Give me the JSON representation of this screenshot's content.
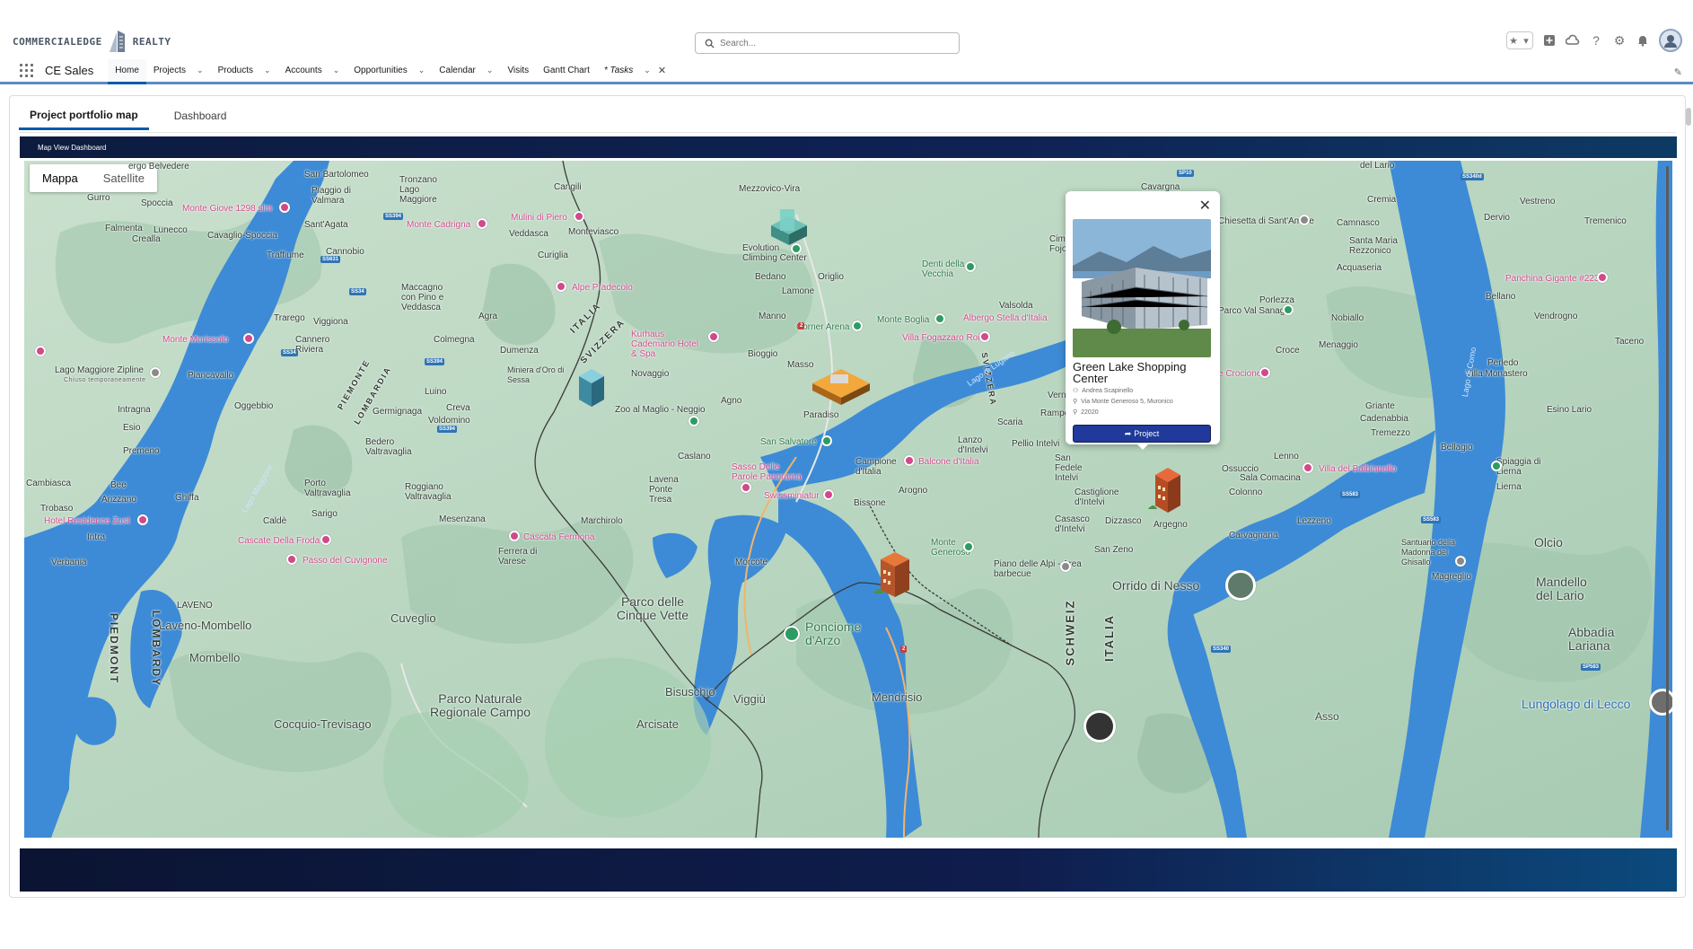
{
  "brand": {
    "name_left": "COMMERCIALEDGE",
    "name_right": "REALTY"
  },
  "search": {
    "placeholder": "Search..."
  },
  "utility_icons": [
    "favorites-star-icon",
    "add-icon",
    "cloud-icon",
    "help-icon",
    "setup-gear-icon",
    "notification-bell-icon",
    "user-avatar-icon"
  ],
  "nav": {
    "app_name": "CE Sales",
    "items": [
      {
        "label": "Home",
        "dropdown": false,
        "active": true
      },
      {
        "label": "Projects",
        "dropdown": true
      },
      {
        "label": "Products",
        "dropdown": true
      },
      {
        "label": "Accounts",
        "dropdown": true
      },
      {
        "label": "Opportunities",
        "dropdown": true
      },
      {
        "label": "Calendar",
        "dropdown": true
      },
      {
        "label": "Visits",
        "dropdown": false
      },
      {
        "label": "Gantt Chart",
        "dropdown": false
      },
      {
        "label": "* Tasks",
        "dropdown": true,
        "closable": true
      }
    ]
  },
  "page_tabs": [
    {
      "label": "Project portfolio map",
      "active": true
    },
    {
      "label": "Dashboard",
      "active": false
    }
  ],
  "map_banner": {
    "title": "Map View Dashboard"
  },
  "map": {
    "type_toggle": {
      "map": "Mappa",
      "satellite": "Satellite",
      "selected": "Mappa"
    },
    "labels": {
      "san_bartolomeo": "San Bartolomeo",
      "tronzano": "Tronzano Lago Maggiore",
      "cannobio": "Cannobio",
      "gurro": "Gurro",
      "spoccia": "Spoccia",
      "piaggio": "Piaggio di Valmara",
      "falmenta": "Falmenta",
      "crealla": "Crealla",
      "lunecco": "Lunecco",
      "cavaglio": "Cavaglio-Spoccia",
      "santagata": "Sant'Agata",
      "traffiume": "Traffiume",
      "cannero": "Cannero Riviera",
      "maccagno": "Maccagno con Pino e Veddasca",
      "trarego": "Trarego",
      "viggiona": "Viggiona",
      "agra": "Agra",
      "colmegna": "Colmegna",
      "dumenza": "Dumenza",
      "piancavallo": "Piancavallo",
      "luino": "Luino",
      "germignaga": "Germignaga",
      "creva": "Creva",
      "voldomino": "Voldomino",
      "intragna": "Intragna",
      "esio": "Esio",
      "oggebbio": "Oggebbio",
      "premeno": "Premeno",
      "bedero": "Bedero Valtravaglia",
      "porto": "Porto Valtravaglia",
      "roggiano": "Roggiano Valtravaglia",
      "cambiasca": "Cambiasca",
      "bee": "Bee",
      "ghiffa": "Ghiffa",
      "arizzano": "Arizzano",
      "trobaso": "Trobaso",
      "sarigo": "Sarigo",
      "calde": "Caldè",
      "mesenzana": "Mesenzana",
      "marchirolo": "Marchirolo",
      "intra": "Intra",
      "verbania": "Verbania",
      "ferrera": "Ferrera di Varese",
      "laveno": "LAVENO",
      "laveno_m": "Laveno-Mombello",
      "mombello": "Mombello",
      "cuveglio": "Cuveglio",
      "cocquio": "Cocquio-Trevisago",
      "cinque_vette": "Parco delle Cinque Vette",
      "campo": "Parco Naturale Regionale Campo",
      "arcisate": "Arcisate",
      "bisuschio": "Bisuschio",
      "viggiu": "Viggiù",
      "mendrisio": "Mendrisio",
      "cangili": "Cangili",
      "mezzovico": "Mezzovico-Vira",
      "veddasca": "Veddasca",
      "monteviasco": "Monteviasco",
      "curiglia": "Curiglia",
      "novaggio": "Novaggio",
      "agno": "Agno",
      "bioggio": "Bioggio",
      "manno": "Manno",
      "lamone": "Lamone",
      "origlio": "Origlio",
      "bedano": "Bedano",
      "evolution": "Evolution Climbing Center",
      "paradiso": "Paradiso",
      "caslano": "Caslano",
      "lavena": "Lavena Ponte Tresa",
      "san_salvatore": "San Salvatore",
      "morcote": "Morcote",
      "bissone": "Bissone",
      "campione": "Campione d'Italia",
      "arogno": "Arogno",
      "monte_generoso": "Monte Generoso",
      "ponciome": "Ponciome d'Arzo",
      "valsolda": "Valsolda",
      "lanzo": "Lanzo d'Intelvi",
      "pellio": "Pellio Intelvi",
      "scaria": "Scaria",
      "san_fedele": "San Fedele Intelvi",
      "castiglione": "Castiglione d'Intelvi",
      "dizzasco": "Dizzasco",
      "casasco": "Casasco d'Intelvi",
      "argegno": "Argegno",
      "san_zeno": "San Zeno",
      "orrido": "Orrido di Nesso",
      "lungolago": "Lungolago di Lecco",
      "asso": "Asso",
      "cavargna": "Cavargna",
      "del_lario": "del Lario",
      "cremia": "Cremia",
      "vestreno": "Vestreno",
      "dervio": "Dervio",
      "tremenico": "Tremenico",
      "camnasco": "Camnasco",
      "santa_maria": "Santa Maria Rezzonico",
      "acquaseria": "Acquaseria",
      "bellano": "Bellano",
      "nobiallo": "Nobiallo",
      "vendrogno": "Vendrogno",
      "menaggio": "Menaggio",
      "croce": "Croce",
      "taceno": "Taceno",
      "perledo": "Perledo",
      "griante": "Griante",
      "cadenabbia": "Cadenabbia",
      "tremezzo": "Tremezzo",
      "esino": "Esino Lario",
      "bellagio": "Bellagio",
      "lenno": "Lenno",
      "ossuccio": "Ossuccio",
      "sala": "Sala Comacina",
      "colonno": "Colonno",
      "lezzeno": "Lezzeno",
      "lierna": "Lierna",
      "spiaggia": "Spiaggia di Lierna",
      "olcio": "Olcio",
      "magreglio": "Magreglio",
      "mandello": "Mandello del Lario",
      "abbadia": "Abbadia Lariana",
      "carvagnana": "Carvagnana",
      "piemonte": "PIEMONTE",
      "lombardia": "LOMBARDIA",
      "piedmont": "PIEDMONT",
      "lombardy": "LOMBARDY",
      "italia": "ITALIA",
      "svizzera": "SVIZZERA",
      "schweiz": "SCHWEIZ",
      "svizzera_v": "SVIZZERA",
      "monte_giove": "Monte Giove 1298 slm",
      "monte_cadrigna": "Monte Cadrigna",
      "monte_morissolo": "Monte Morissolo",
      "lago_maggiore_zipline": "Lago Maggiore Zipline",
      "zipline_sub": "Chiuso temporaneamente",
      "alpe_pradecolo": "Alpe Pradecolo",
      "kurhaus": "Kurhaus Cademario Hotel & Spa",
      "miniera": "Miniera d'Oro di Sessa",
      "zoo": "Zoo al Maglio - Neggio",
      "cascate": "Cascate Della Froda",
      "passo": "Passo del Cuvignone",
      "cascata_fermona": "Cascata Fermona",
      "hotel_residence": "Hotel Residence Zust",
      "monte_boglia": "Monte Boglia",
      "albergo_stella": "Albergo Stella d'Italia",
      "villa_fogazzaro": "Villa Fogazzaro Roi",
      "denti": "Denti della Vecchia",
      "sasso": "Sasso Delle Parole Panorama",
      "swissminiatur": "Swissminiatur",
      "balcone": "Balcone d'Italia",
      "alpe_biscotto": "Piano delle Alpi - Area barbecue",
      "villa_balbianello": "Villa del Balbianello",
      "chiesetta": "Chiesetta di Sant'Amate",
      "panchina": "Panchina Gigante #223",
      "piazza_crocione": "e Crocione",
      "porlezza": "Porlezza",
      "parco_val_sanagra": "Parco Val Sanagra",
      "villa_monastero": "Villa Monastero",
      "santuario": "Santuario della Madonna del Ghisallo",
      "rampo": "Rampo",
      "vern": "Vern",
      "cima": "Cima di Fojorina",
      "mulini": "Mulini di Piero",
      "lago_lugano": "Lago di Lugano",
      "lago_como": "Lago di Como",
      "lago_maggiore": "Lago Maggiore",
      "comer_arena": "Corner Arena",
      "masso": "Masso",
      "belvedere": "ergo Belvedere"
    }
  },
  "popup": {
    "title": "Green Lake Shopping Center",
    "owner": "Andrea Scapinello",
    "address": "Via Monte Generoso 5, Muronico",
    "zip": "22020",
    "button": "Project"
  },
  "colors": {
    "nav_accent": "#0b5cab",
    "banner": "#0f2254",
    "project_button": "#20399a",
    "water": "#3d8bd6",
    "land": "#b7d5c2"
  }
}
